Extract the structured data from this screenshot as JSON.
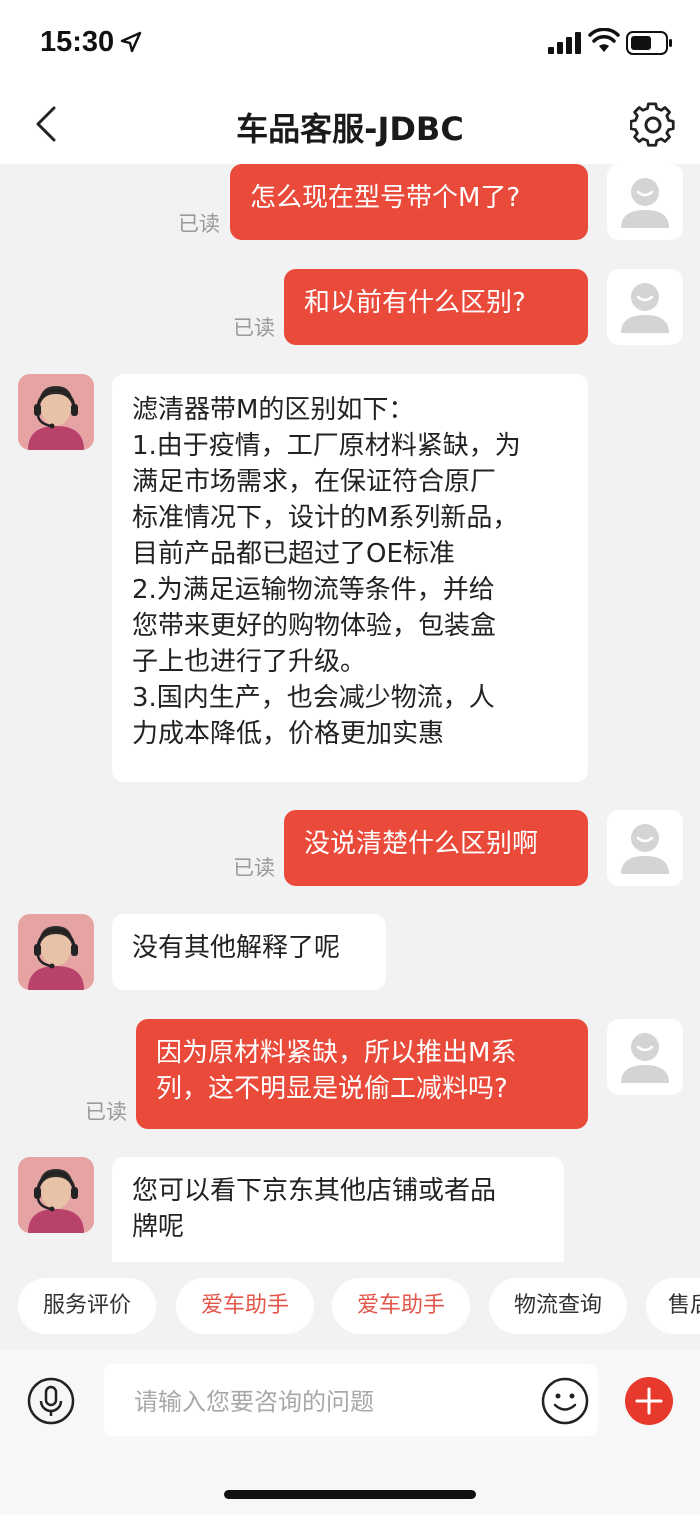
{
  "status_bar": {
    "time": "15:30",
    "icons": [
      "location-arrow-icon",
      "signal-icon",
      "wifi-icon",
      "battery-icon"
    ]
  },
  "nav": {
    "title": "车品客服-JDBC",
    "icons": [
      "back-icon",
      "settings-icon"
    ]
  },
  "messages": [
    {
      "sender": "user",
      "read": "已读",
      "text": "怎么现在型号带个M了?"
    },
    {
      "sender": "user",
      "read": "已读",
      "text": "和以前有什么区别?"
    },
    {
      "sender": "agent",
      "lines": [
        "滤清器带M的区别如下：",
        "1.由于疫情，工厂原材料紧缺，为",
        "满足市场需求，在保证符合原厂",
        "标准情况下，设计的M系列新品，",
        "目前产品都已超过了OE标准",
        "2.为满足运输物流等条件，并给",
        "您带来更好的购物体验，包装盒",
        "子上也进行了升级。",
        "3.国内生产，也会减少物流，人",
        "力成本降低，价格更加实惠"
      ]
    },
    {
      "sender": "user",
      "read": "已读",
      "text": "没说清楚什么区别啊"
    },
    {
      "sender": "agent",
      "lines": [
        "没有其他解释了呢"
      ]
    },
    {
      "sender": "user",
      "read": "已读",
      "lines": [
        "因为原材料紧缺，所以推出M系",
        "列，这不明显是说偷工减料吗?"
      ]
    },
    {
      "sender": "agent",
      "lines": [
        "您可以看下京东其他店铺或者品",
        "牌呢"
      ]
    }
  ],
  "quick_replies": [
    "服务评价",
    "爱车助手",
    "爱车助手",
    "物流查询",
    "售后"
  ],
  "input": {
    "placeholder": "请输入您要咨询的问题",
    "icons": [
      "microphone-icon",
      "emoji-icon",
      "plus-icon"
    ]
  },
  "colors": {
    "outgoing_bubble": "#ea4a3a",
    "accent_text": "#e2574a",
    "plus_button": "#e8392d"
  }
}
